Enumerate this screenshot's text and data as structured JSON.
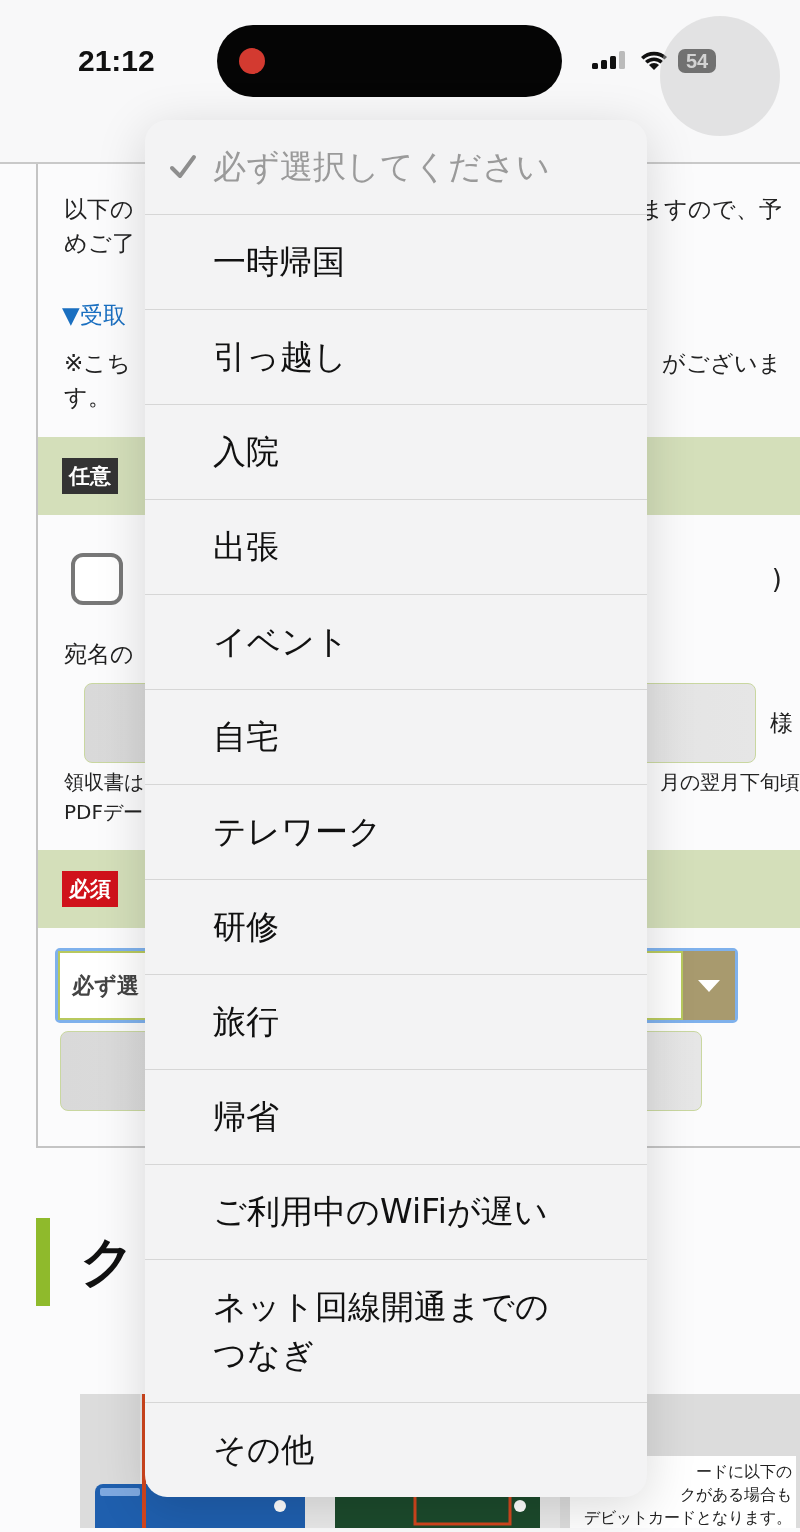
{
  "status_bar": {
    "time": "21:12",
    "battery": "54"
  },
  "form": {
    "rows": [
      {
        "kind": "text",
        "left": "以下の",
        "right": "ますので、予"
      },
      {
        "kind": "text",
        "left": "めご了"
      },
      {
        "kind": "link",
        "left": "▼受取"
      },
      {
        "kind": "text",
        "left": "※こち",
        "right": "がございま"
      },
      {
        "kind": "text",
        "left": "す。"
      },
      {
        "kind": "band",
        "badge": "任意",
        "required": false
      },
      {
        "kind": "checkbox",
        "checked": false,
        "right": ")"
      },
      {
        "kind": "text",
        "left": "宛名の"
      },
      {
        "kind": "input",
        "suffix": "様"
      },
      {
        "kind": "small",
        "left": "領収書は",
        "right": "月の翌月下旬頃"
      },
      {
        "kind": "small",
        "left": "PDFデー"
      },
      {
        "kind": "band",
        "badge": "必須",
        "required": true
      },
      {
        "kind": "select",
        "value": "必ず選"
      },
      {
        "kind": "field"
      }
    ]
  },
  "section_heading": "ク",
  "card_note": {
    "kind": "picture",
    "lines": [
      "ードに以下の",
      "クがある場合も",
      "デビットカードとなります。"
    ]
  },
  "picker": {
    "options": [
      {
        "label": "必ず選択してください",
        "selected": true,
        "disabled": true
      },
      {
        "label": "一時帰国",
        "selected": false,
        "disabled": false
      },
      {
        "label": "引っ越し",
        "selected": false,
        "disabled": false
      },
      {
        "label": "入院",
        "selected": false,
        "disabled": false
      },
      {
        "label": "出張",
        "selected": false,
        "disabled": false
      },
      {
        "label": "イベント",
        "selected": false,
        "disabled": false
      },
      {
        "label": "自宅",
        "selected": false,
        "disabled": false
      },
      {
        "label": "テレワーク",
        "selected": false,
        "disabled": false
      },
      {
        "label": "研修",
        "selected": false,
        "disabled": false
      },
      {
        "label": "旅行",
        "selected": false,
        "disabled": false
      },
      {
        "label": "帰省",
        "selected": false,
        "disabled": false
      },
      {
        "label": "ご利用中のWiFiが遅い",
        "selected": false,
        "disabled": false
      },
      {
        "label": "ネット回線開通までのつなぎ",
        "selected": false,
        "disabled": false
      },
      {
        "label": "その他",
        "selected": false,
        "disabled": false
      }
    ]
  }
}
